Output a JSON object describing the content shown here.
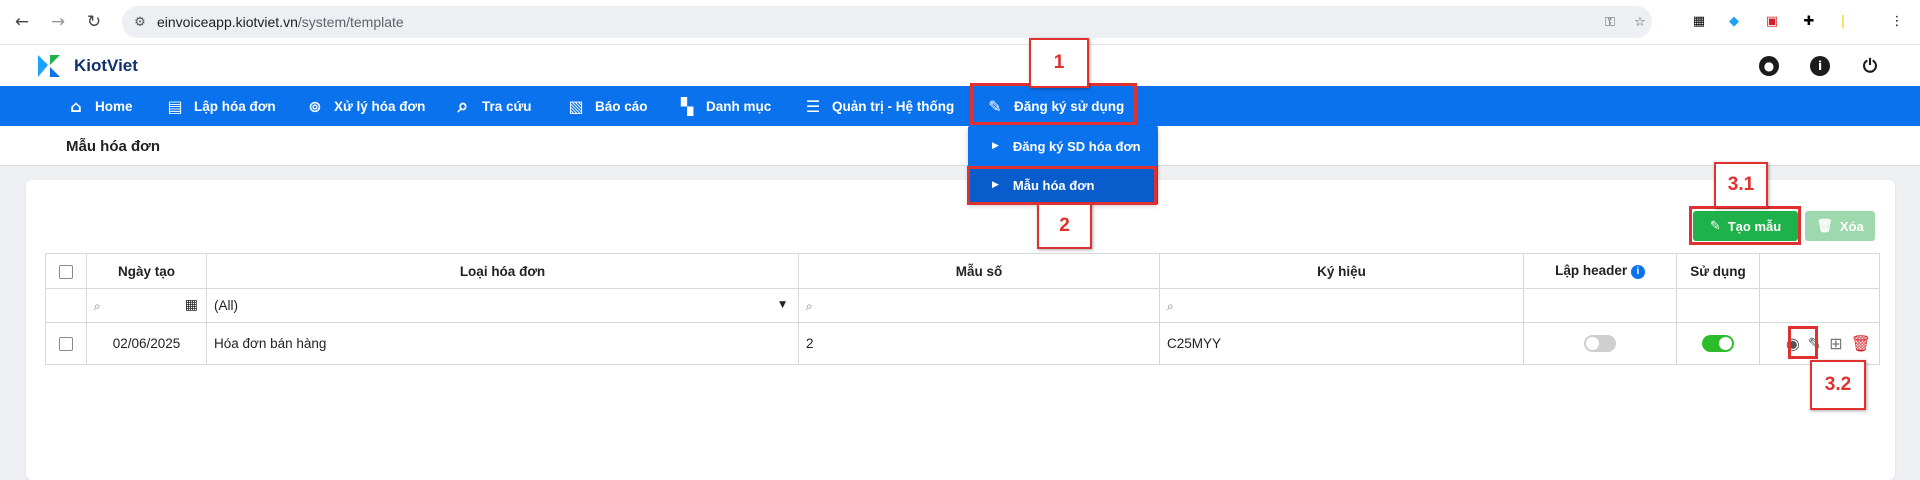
{
  "browser": {
    "url_host": "einvoiceapp.kiotviet.vn",
    "url_path": "/system/template"
  },
  "app": {
    "brand": "KiotViet"
  },
  "nav": {
    "items": [
      {
        "label": "Home",
        "icon": "home-icon"
      },
      {
        "label": "Lập hóa đơn",
        "icon": "invoice-create-icon"
      },
      {
        "label": "Xử lý hóa đơn",
        "icon": "invoice-process-icon"
      },
      {
        "label": "Tra cứu",
        "icon": "search-icon"
      },
      {
        "label": "Báo cáo",
        "icon": "report-icon"
      },
      {
        "label": "Danh mục",
        "icon": "category-icon"
      },
      {
        "label": "Quản trị - Hệ thống",
        "icon": "admin-system-icon"
      },
      {
        "label": "Đăng ký sử dụng",
        "icon": "register-icon"
      }
    ],
    "dropdown": [
      {
        "label": "Đăng ký SD hóa đơn"
      },
      {
        "label": "Mẫu hóa đơn"
      }
    ]
  },
  "page": {
    "title": "Mẫu hóa đơn"
  },
  "toolbar": {
    "create_label": "Tạo mẫu",
    "delete_label": "Xóa"
  },
  "table": {
    "headers": {
      "created_date": "Ngày tạo",
      "invoice_type": "Loại hóa đơn",
      "form_number": "Mẫu số",
      "symbol": "Ký hiệu",
      "header_setup": "Lập header",
      "in_use": "Sử dụng"
    },
    "filters": {
      "invoice_type": "(All)"
    },
    "rows": [
      {
        "created_date": "02/06/2025",
        "invoice_type": "Hóa đơn bán hàng",
        "form_number": "2",
        "symbol": "C25MYY",
        "header_setup": false,
        "in_use": true
      }
    ]
  },
  "annotations": {
    "step1": "1",
    "step2": "2",
    "step3_1": "3.1",
    "step3_2": "3.2"
  },
  "colors": {
    "nav_blue": "#0b72ee",
    "create_green": "#1fb14a",
    "delete_green_disabled": "#9ed9ad",
    "toggle_on": "#2ebd2a",
    "annotation_red": "#e03131"
  }
}
